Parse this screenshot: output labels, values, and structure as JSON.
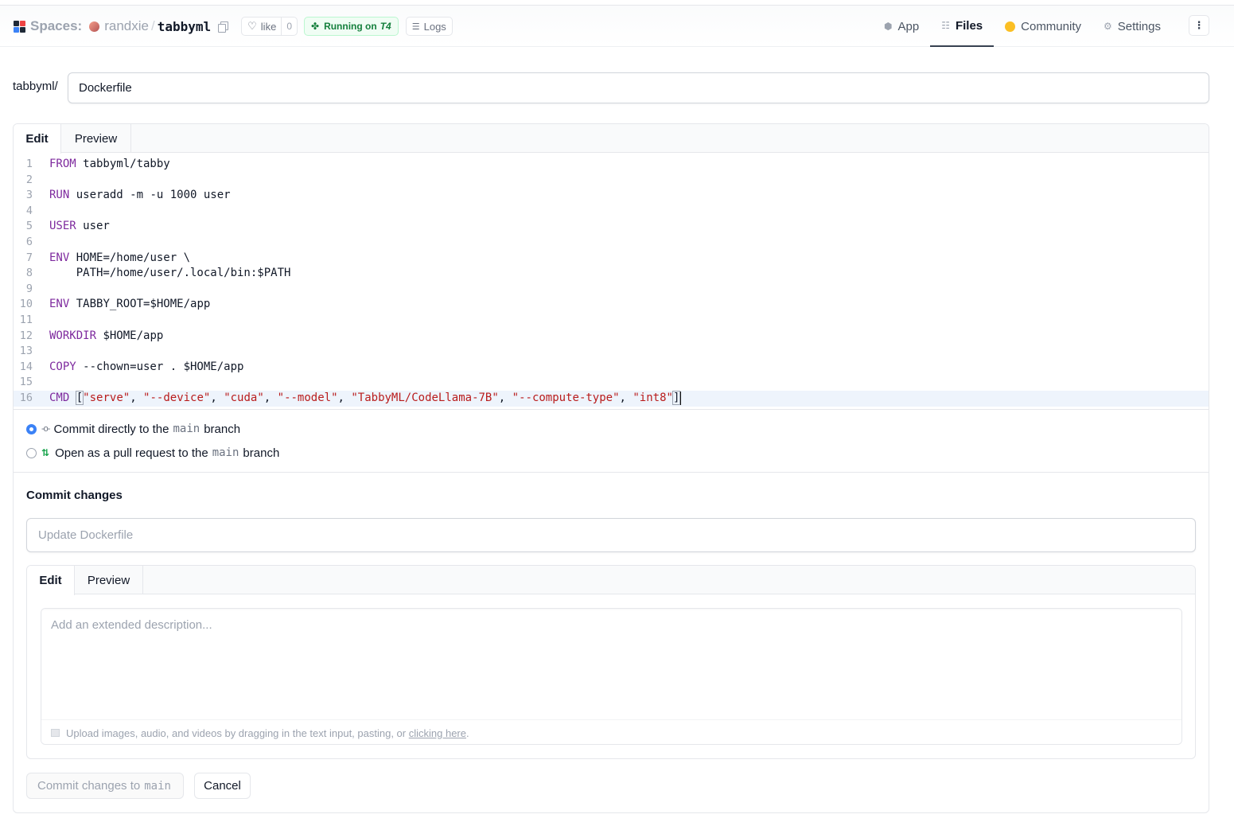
{
  "header": {
    "spaces_label": "Spaces:",
    "owner": "randxie",
    "separator": "/",
    "repo": "tabbyml",
    "like_label": "like",
    "like_count": "0",
    "running_label": "Running on",
    "running_hardware": "T4",
    "logs_label": "Logs",
    "nav": [
      {
        "label": "App",
        "icon": "cube-icon"
      },
      {
        "label": "Files",
        "icon": "files-icon",
        "active": true
      },
      {
        "label": "Community",
        "icon": "community-icon"
      },
      {
        "label": "Settings",
        "icon": "gear-icon"
      }
    ],
    "more_icon": "⋮"
  },
  "path": {
    "prefix": "tabbyml/",
    "filename": "Dockerfile"
  },
  "editor": {
    "tabs": [
      "Edit",
      "Preview"
    ],
    "current_line": 16,
    "lines": [
      {
        "n": "1",
        "kw": "FROM",
        "rest": " tabbyml/tabby"
      },
      {
        "n": "2",
        "kw": "",
        "rest": ""
      },
      {
        "n": "3",
        "kw": "RUN",
        "rest": " useradd -m -u 1000 user"
      },
      {
        "n": "4",
        "kw": "",
        "rest": ""
      },
      {
        "n": "5",
        "kw": "USER",
        "rest": " user"
      },
      {
        "n": "6",
        "kw": "",
        "rest": ""
      },
      {
        "n": "7",
        "kw": "ENV",
        "rest": " HOME=/home/user \\"
      },
      {
        "n": "8",
        "kw": "",
        "rest": "    PATH=/home/user/.local/bin:$PATH"
      },
      {
        "n": "9",
        "kw": "",
        "rest": ""
      },
      {
        "n": "10",
        "kw": "ENV",
        "rest": " TABBY_ROOT=$HOME/app"
      },
      {
        "n": "11",
        "kw": "",
        "rest": ""
      },
      {
        "n": "12",
        "kw": "WORKDIR",
        "rest": " $HOME/app"
      },
      {
        "n": "13",
        "kw": "",
        "rest": ""
      },
      {
        "n": "14",
        "kw": "COPY",
        "rest": " --chown=user . $HOME/app"
      },
      {
        "n": "15",
        "kw": "",
        "rest": ""
      },
      {
        "n": "16",
        "kw": "CMD",
        "rest": " ",
        "args": [
          "\"serve\"",
          "\"--device\"",
          "\"cuda\"",
          "\"--model\"",
          "\"TabbyML/CodeLlama-7B\"",
          "\"--compute-type\"",
          "\"int8\""
        ]
      }
    ]
  },
  "commit_options": {
    "direct": {
      "before": "Commit directly to the",
      "branch": "main",
      "after": "branch",
      "selected": true
    },
    "pr": {
      "before": "Open as a pull request to the",
      "branch": "main",
      "after": "branch",
      "selected": false
    }
  },
  "commit": {
    "title": "Commit changes",
    "summary_placeholder": "Update Dockerfile",
    "desc_tabs": [
      "Edit",
      "Preview"
    ],
    "desc_placeholder": "Add an extended description...",
    "upload_text": "Upload images, audio, and videos by dragging in the text input, pasting, or",
    "upload_link": "clicking here",
    "upload_end": ".",
    "commit_button_label": "Commit changes to",
    "commit_button_branch": "main",
    "cancel_label": "Cancel"
  }
}
